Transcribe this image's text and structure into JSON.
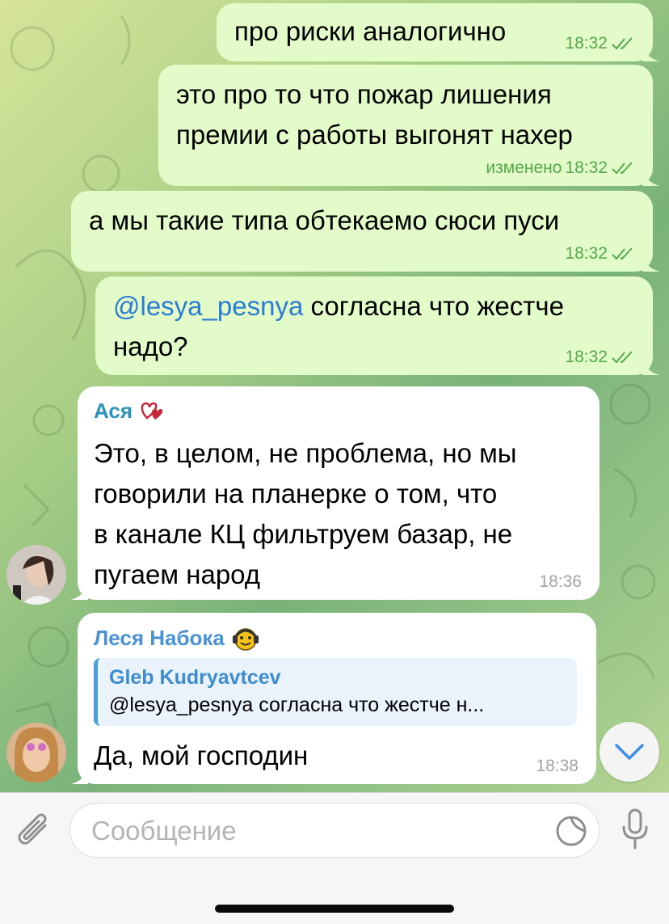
{
  "colors": {
    "outgoing_bubble": "#e2fbc8",
    "incoming_bubble": "#ffffff",
    "check_marks": "#55a84a",
    "mention": "#2b7bd2",
    "sender_asya": "#2a93b8",
    "sender_lesya": "#4a92d2"
  },
  "messages": [
    {
      "text": "про риски аналогично",
      "time": "18:32"
    },
    {
      "text_line1": "это про то что пожар лишения",
      "text_line2": "премии с работы выгонят нахер",
      "edited_label": "изменено",
      "time": "18:32"
    },
    {
      "text": "а мы такие типа обтекаемо сюси пуси",
      "time": "18:32"
    },
    {
      "mention": "@lesya_pesnya",
      "text_line1": " согласна что жестче",
      "text_line2": "надо?",
      "time": "18:32"
    },
    {
      "sender": "Ася",
      "text_line1": "Это, в целом, не проблема, но мы",
      "text_line2": "говорили на планерке о том, что",
      "text_line3": "в канале КЦ фильтруем базар, не",
      "text_line4": "пугаем народ",
      "time": "18:36"
    },
    {
      "sender": "Леся Набока",
      "reply_name": "Gleb Kudryavtcev",
      "reply_text": "@lesya_pesnya согласна что жестче н...",
      "text": "Да, мой господин",
      "time": "18:38"
    }
  ],
  "icons": [
    "double-check-icon",
    "heart-badge-icon",
    "smiley-headphones-icon",
    "chevron-down-icon",
    "paperclip-icon",
    "sticker-icon",
    "microphone-icon"
  ],
  "composer": {
    "placeholder": "Сообщение"
  }
}
